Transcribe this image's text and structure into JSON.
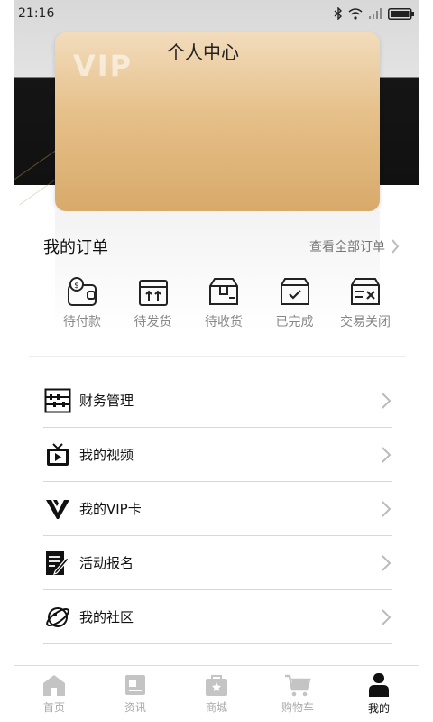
{
  "status_bar": {
    "time": "21:16"
  },
  "page_title": "个人中心",
  "vip_card": {
    "watermark": "VIP"
  },
  "orders": {
    "title": "我的订单",
    "view_all": "查看全部订单",
    "items": [
      {
        "label": "待付款",
        "icon": "wallet-icon"
      },
      {
        "label": "待发货",
        "icon": "box-arrows-icon"
      },
      {
        "label": "待收货",
        "icon": "package-icon"
      },
      {
        "label": "已完成",
        "icon": "box-check-icon"
      },
      {
        "label": "交易关闭",
        "icon": "box-x-icon"
      }
    ]
  },
  "menu": [
    {
      "label": "财务管理",
      "icon": "abacus-icon"
    },
    {
      "label": "我的视频",
      "icon": "tv-icon"
    },
    {
      "label": "我的VIP卡",
      "icon": "vip-logo-icon"
    },
    {
      "label": "活动报名",
      "icon": "signup-pen-icon"
    },
    {
      "label": "我的社区",
      "icon": "planet-icon"
    }
  ],
  "tabbar": [
    {
      "label": "首页",
      "icon": "home-icon"
    },
    {
      "label": "资讯",
      "icon": "news-icon"
    },
    {
      "label": "商城",
      "icon": "shop-icon"
    },
    {
      "label": "购物车",
      "icon": "cart-icon"
    },
    {
      "label": "我的",
      "icon": "profile-icon",
      "active": true
    }
  ],
  "colors": {
    "card_gold": "#dcae6c",
    "active_tab": "#111111",
    "inactive_tab": "#aaaaaa"
  }
}
